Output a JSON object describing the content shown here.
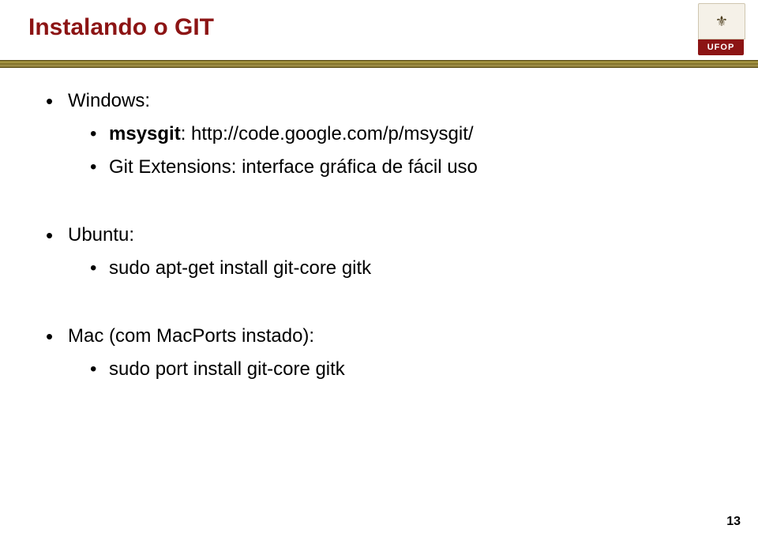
{
  "logo": {
    "label": "UFOP",
    "emblem_glyph": "⚜"
  },
  "title": "Instalando o GIT",
  "sections": [
    {
      "heading": "Windows:",
      "items": [
        {
          "prefix": "msysgit",
          "suffix": ": http://code.google.com/p/msysgit/"
        },
        {
          "prefix": "",
          "suffix": "Git Extensions: interface gráfica de fácil uso"
        }
      ]
    },
    {
      "heading": "Ubuntu:",
      "items": [
        {
          "prefix": "",
          "suffix": "sudo apt-get install git-core gitk"
        }
      ]
    },
    {
      "heading": "Mac (com MacPorts instado):",
      "items": [
        {
          "prefix": "",
          "suffix": "sudo port install git-core gitk"
        }
      ]
    }
  ],
  "page_number": "13"
}
